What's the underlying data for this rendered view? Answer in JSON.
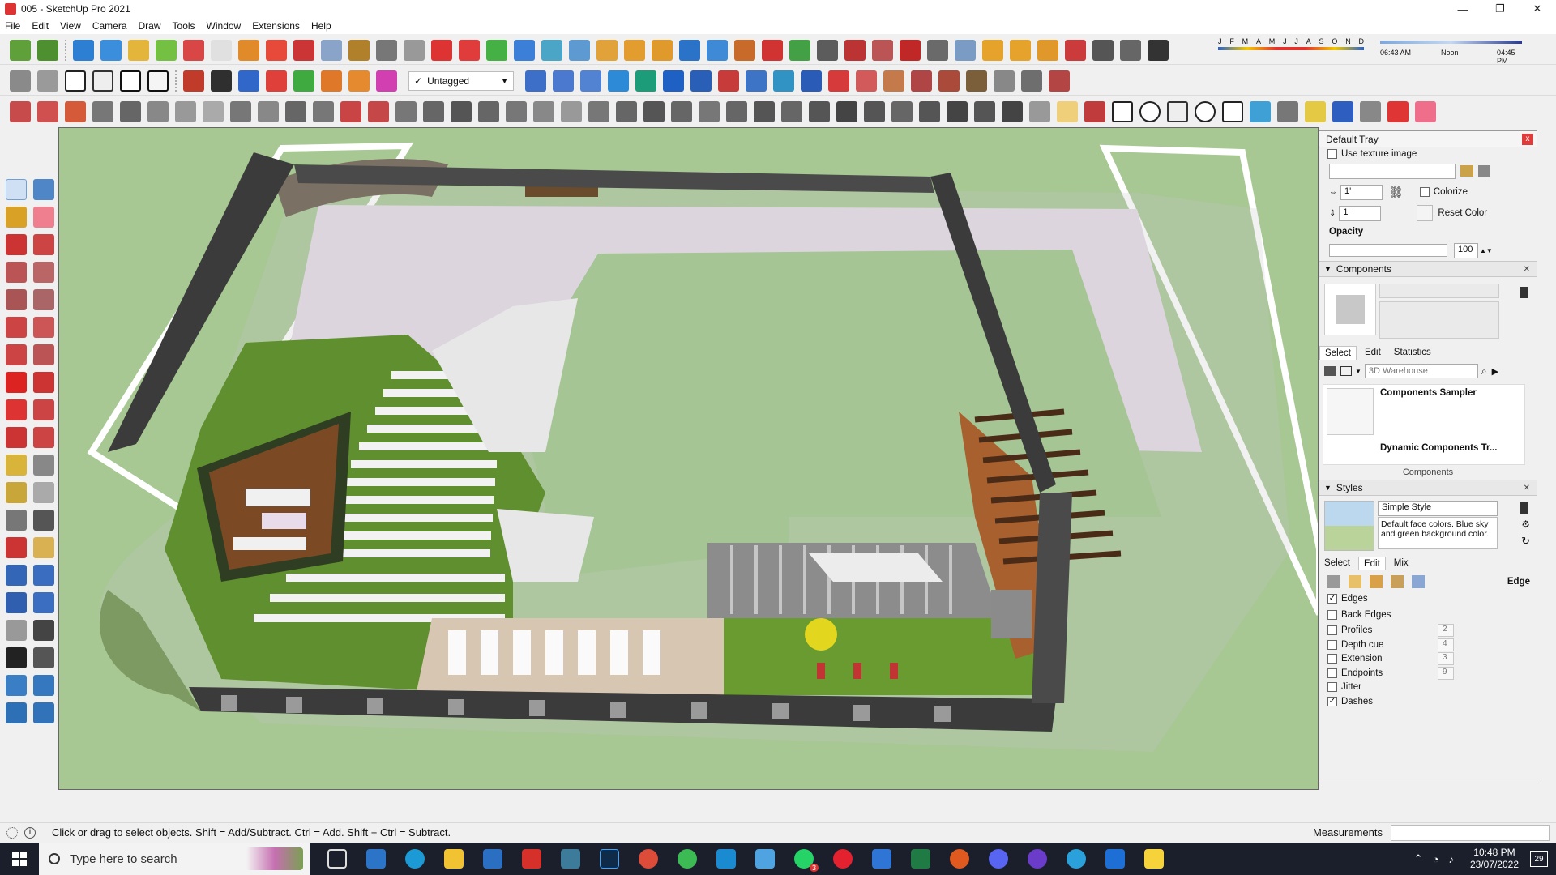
{
  "window": {
    "title": "005 - SketchUp Pro 2021",
    "controls": [
      "—",
      "❐",
      "✕"
    ]
  },
  "menu": [
    "File",
    "Edit",
    "View",
    "Camera",
    "Draw",
    "Tools",
    "Window",
    "Extensions",
    "Help"
  ],
  "toolbar": {
    "tag_value": "Untagged",
    "tag_check": "✓"
  },
  "shadow": {
    "months": [
      "J",
      "F",
      "M",
      "A",
      "M",
      "J",
      "J",
      "A",
      "S",
      "O",
      "N",
      "D"
    ],
    "time_start": "06:43 AM",
    "time_mid": "Noon",
    "time_end": "04:45 PM"
  },
  "tray": {
    "title": "Default Tray",
    "close": "x",
    "materials": {
      "use_texture": "Use texture image",
      "width": "1'",
      "height": "1'",
      "colorize": "Colorize",
      "reset_color": "Reset Color",
      "opacity_label": "Opacity",
      "opacity_value": "100"
    },
    "components": {
      "header": "Components",
      "tabs": [
        "Select",
        "Edit",
        "Statistics"
      ],
      "search_placeholder": "3D Warehouse",
      "items": [
        "Components Sampler",
        "Dynamic Components Tr..."
      ],
      "footer": "Components"
    },
    "styles": {
      "header": "Styles",
      "style_name": "Simple Style",
      "style_desc": "Default face colors. Blue sky and green background color.",
      "tabs": [
        "Select",
        "Edit",
        "Mix"
      ],
      "edge_label": "Edge",
      "edge_settings": [
        {
          "label": "Edges",
          "checked": true,
          "value": ""
        },
        {
          "label": "Back Edges",
          "checked": false,
          "value": ""
        },
        {
          "label": "Profiles",
          "checked": false,
          "value": "2"
        },
        {
          "label": "Depth cue",
          "checked": false,
          "value": "4"
        },
        {
          "label": "Extension",
          "checked": false,
          "value": "3"
        },
        {
          "label": "Endpoints",
          "checked": false,
          "value": "9"
        },
        {
          "label": "Jitter",
          "checked": false,
          "value": ""
        },
        {
          "label": "Dashes",
          "checked": true,
          "value": ""
        }
      ]
    }
  },
  "status": {
    "message": "Click or drag to select objects. Shift = Add/Subtract. Ctrl = Add. Shift + Ctrl = Subtract.",
    "measurements_label": "Measurements"
  },
  "taskbar": {
    "search_placeholder": "Type here to search",
    "time": "10:48 PM",
    "date": "23/07/2022",
    "notifications": "29",
    "whatsapp_badge": "3"
  },
  "colors": {
    "grass": "#5f8f2e",
    "deck": "#7b4a24",
    "wall": "#3b3b3b",
    "plaza": "#d9d2dc",
    "lawn": "#a7c793",
    "sky_bg": "#a7c793"
  }
}
